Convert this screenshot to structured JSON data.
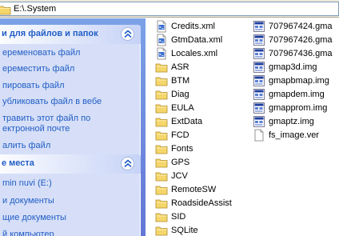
{
  "address_bar": {
    "path": "E:\\.System"
  },
  "task_pane": {
    "file_tasks": {
      "title": "и для файлов и папок",
      "items": [
        "еременовать файл",
        "ереместить файл",
        "пировать файл",
        "убликовать файл в вебе",
        "травить этот файл по",
        "ектронной почте",
        "алить файл"
      ]
    },
    "other_places": {
      "title": "е места",
      "items": [
        "min nuvi (E:)",
        "и документы",
        "щие документы",
        "й компьютер"
      ]
    }
  },
  "files": {
    "column1": [
      {
        "name": "Credits.xml",
        "icon": "xml-file-icon"
      },
      {
        "name": "GtmData.xml",
        "icon": "xml-file-icon"
      },
      {
        "name": "Locales.xml",
        "icon": "xml-file-icon"
      },
      {
        "name": "ASR",
        "icon": "folder-icon"
      },
      {
        "name": "BTM",
        "icon": "folder-icon"
      },
      {
        "name": "Diag",
        "icon": "folder-icon"
      },
      {
        "name": "EULA",
        "icon": "folder-icon"
      },
      {
        "name": "ExtData",
        "icon": "folder-icon"
      },
      {
        "name": "FCD",
        "icon": "folder-icon"
      },
      {
        "name": "Fonts",
        "icon": "folder-icon"
      },
      {
        "name": "GPS",
        "icon": "folder-icon"
      },
      {
        "name": "JCV",
        "icon": "folder-icon"
      },
      {
        "name": "RemoteSW",
        "icon": "folder-icon"
      },
      {
        "name": "RoadsideAssist",
        "icon": "folder-icon"
      },
      {
        "name": "SID",
        "icon": "folder-icon"
      },
      {
        "name": "SQLite",
        "icon": "folder-icon"
      }
    ],
    "column2": [
      {
        "name": "707967424.gma",
        "icon": "gma-file-icon"
      },
      {
        "name": "707967426.gma",
        "icon": "gma-file-icon"
      },
      {
        "name": "707967436.gma",
        "icon": "gma-file-icon"
      },
      {
        "name": "gmap3d.img",
        "icon": "img-file-icon"
      },
      {
        "name": "gmapbmap.img",
        "icon": "img-file-icon"
      },
      {
        "name": "gmapdem.img",
        "icon": "img-file-icon"
      },
      {
        "name": "gmapprom.img",
        "icon": "img-file-icon"
      },
      {
        "name": "gmaptz.img",
        "icon": "img-file-icon"
      },
      {
        "name": "fs_image.ver",
        "icon": "ver-file-icon"
      }
    ]
  },
  "colors": {
    "pane_gradient_top": "#7ba2e7",
    "pane_body": "#d6dff7",
    "link_blue": "#215dc6",
    "folder_yellow": "#f5d66b"
  }
}
